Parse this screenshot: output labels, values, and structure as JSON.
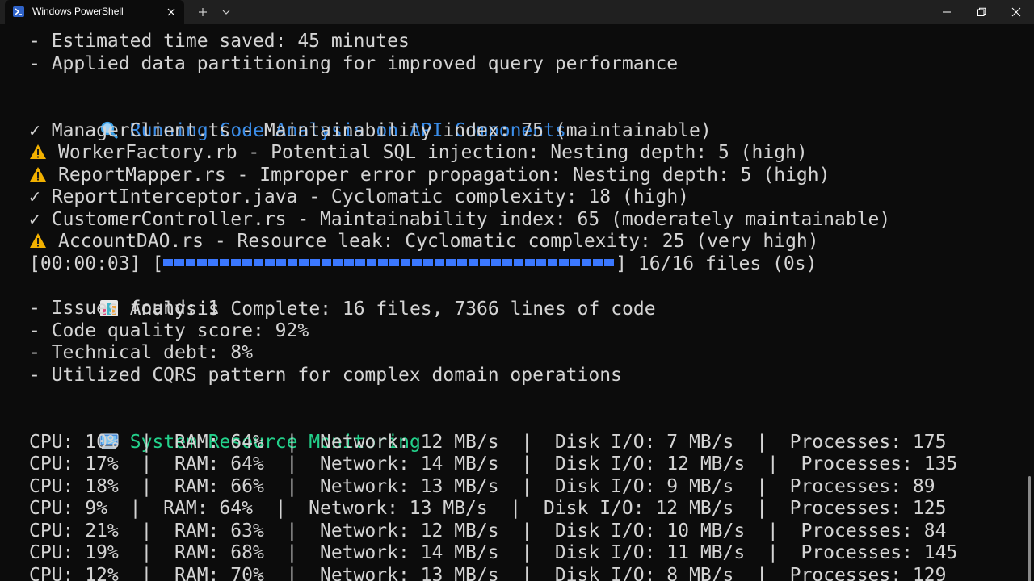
{
  "window": {
    "tab_title": "Windows PowerShell",
    "icons": [
      "powershell-icon",
      "close-icon",
      "plus-icon",
      "chevron-down-icon",
      "minimize-icon",
      "maximize-icon",
      "window-close-icon"
    ]
  },
  "terminal": {
    "prev": [
      "- Estimated time saved: 45 minutes",
      "- Applied data partitioning for improved query performance"
    ],
    "analysis": {
      "heading": "Running Code Analysis on API Components",
      "results": [
        {
          "status": "check",
          "marker": "✓",
          "text": "ManagerClient.ts - Maintainability index: 75 (maintainable)"
        },
        {
          "status": "warning",
          "marker": "⚠",
          "text": "WorkerFactory.rb - Potential SQL injection: Nesting depth: 5 (high)"
        },
        {
          "status": "warning",
          "marker": "⚠",
          "text": "ReportMapper.rs - Improper error propagation: Nesting depth: 5 (high)"
        },
        {
          "status": "check",
          "marker": "✓",
          "text": "ReportInterceptor.java - Cyclomatic complexity: 18 (high)"
        },
        {
          "status": "check",
          "marker": "✓",
          "text": "CustomerController.rs - Maintainability index: 65 (moderately maintainable)"
        },
        {
          "status": "warning",
          "marker": "⚠",
          "text": "AccountDAO.rs - Resource leak: Cyclomatic complexity: 25 (very high)"
        }
      ],
      "progress": {
        "time": "[00:00:03] [",
        "end": "] 16/16 files (0s)",
        "percent": 100
      },
      "summary": "Analysis Complete: 16 files, 7366 lines of code",
      "details": [
        "- Issues found: 1",
        "- Code quality score: 92%",
        "- Technical debt: 8%",
        "- Utilized CQRS pattern for complex domain operations"
      ]
    },
    "monitor": {
      "heading": "System Resource Monitoring",
      "rows": [
        "CPU: 10%  |  RAM: 64%  |  Network: 12 MB/s  |  Disk I/O: 7 MB/s  |  Processes: 175",
        "CPU: 17%  |  RAM: 64%  |  Network: 14 MB/s  |  Disk I/O: 12 MB/s  |  Processes: 135",
        "CPU: 18%  |  RAM: 66%  |  Network: 13 MB/s  |  Disk I/O: 9 MB/s  |  Processes: 89",
        "CPU: 9%  |  RAM: 64%  |  Network: 13 MB/s  |  Disk I/O: 12 MB/s  |  Processes: 125",
        "CPU: 21%  |  RAM: 63%  |  Network: 12 MB/s  |  Disk I/O: 10 MB/s  |  Processes: 84",
        "CPU: 19%  |  RAM: 68%  |  Network: 14 MB/s  |  Disk I/O: 11 MB/s  |  Processes: 145",
        "CPU: 12%  |  RAM: 70%  |  Network: 13 MB/s  |  Disk I/O: 8 MB/s  |  Processes: 129"
      ]
    },
    "colors": {
      "background": "#0c0c0c",
      "text": "#d4d4d4",
      "heading_blue": "#3b8eea",
      "heading_green": "#23d18b",
      "warning": "#f2b100",
      "progress": "#3b78ff"
    }
  }
}
